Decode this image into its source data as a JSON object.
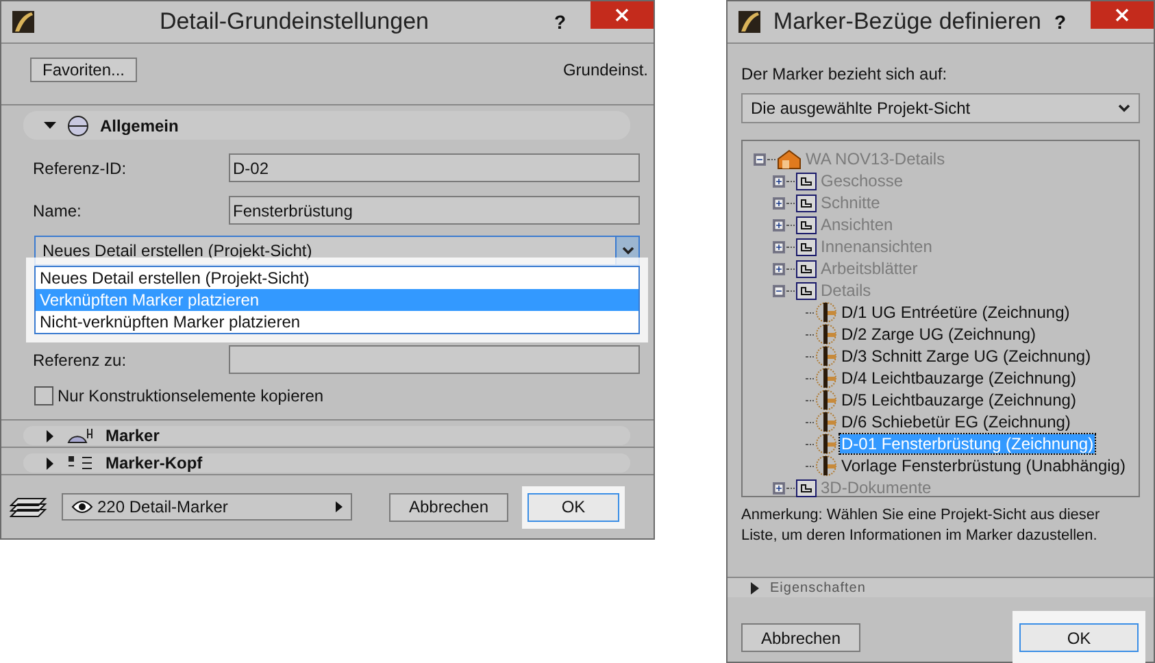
{
  "left_window": {
    "title": "Detail-Grundeinstellungen",
    "help": "?",
    "favorites_button": "Favoriten...",
    "preset_label": "Grundeinst.",
    "sections": [
      {
        "label": "Allgemein",
        "expanded": true
      },
      {
        "label": "Marker",
        "expanded": false
      },
      {
        "label": "Marker-Kopf",
        "expanded": false
      }
    ],
    "reference_id": {
      "label": "Referenz-ID:",
      "value": "D-02"
    },
    "name": {
      "label": "Name:",
      "value": "Fensterbrüstung"
    },
    "mode_dropdown": {
      "value": "Neues Detail erstellen (Projekt-Sicht)",
      "options": [
        {
          "label": "Neues Detail erstellen (Projekt-Sicht)",
          "highlighted": false
        },
        {
          "label": "Verknüpften Marker platzieren",
          "highlighted": true
        },
        {
          "label": "Nicht-verknüpften Marker platzieren",
          "highlighted": false
        }
      ]
    },
    "reference_to": {
      "label": "Referenz zu:"
    },
    "copy_construction_only": {
      "label": "Nur Konstruktionselemente kopieren",
      "checked": false
    },
    "layer_dropdown": "220 Detail-Marker",
    "cancel_button": "Abbrechen",
    "ok_button": "OK"
  },
  "right_window": {
    "title": "Marker-Bezüge definieren",
    "help": "?",
    "refers_label": "Der Marker bezieht sich auf:",
    "refers_dropdown": "Die ausgewählte Projekt-Sicht",
    "tree": [
      {
        "label": "WA NOV13-Details",
        "kind": "root",
        "expanded": true,
        "disabled": true,
        "selected": false,
        "children": [
          {
            "label": "Geschosse",
            "kind": "folder",
            "expanded": false,
            "disabled": true,
            "selected": false
          },
          {
            "label": "Schnitte",
            "kind": "folder",
            "expanded": false,
            "disabled": true,
            "selected": false
          },
          {
            "label": "Ansichten",
            "kind": "folder",
            "expanded": false,
            "disabled": true,
            "selected": false
          },
          {
            "label": "Innenansichten",
            "kind": "folder",
            "expanded": false,
            "disabled": true,
            "selected": false
          },
          {
            "label": "Arbeitsblätter",
            "kind": "folder",
            "expanded": false,
            "disabled": true,
            "selected": false
          },
          {
            "label": "Details",
            "kind": "folder",
            "expanded": true,
            "disabled": true,
            "selected": false,
            "children": [
              {
                "label": "D/1 UG Entréetüre (Zeichnung)",
                "kind": "drawing",
                "disabled": false,
                "selected": false
              },
              {
                "label": "D/2 Zarge UG (Zeichnung)",
                "kind": "drawing",
                "disabled": false,
                "selected": false
              },
              {
                "label": "D/3 Schnitt Zarge UG (Zeichnung)",
                "kind": "drawing",
                "disabled": false,
                "selected": false
              },
              {
                "label": "D/4 Leichtbauzarge (Zeichnung)",
                "kind": "drawing",
                "disabled": false,
                "selected": false
              },
              {
                "label": "D/5 Leichtbauzarge (Zeichnung)",
                "kind": "drawing",
                "disabled": false,
                "selected": false
              },
              {
                "label": "D/6 Schiebetür EG (Zeichnung)",
                "kind": "drawing",
                "disabled": false,
                "selected": false
              },
              {
                "label": "D-01 Fensterbrüstung (Zeichnung)",
                "kind": "drawing",
                "disabled": false,
                "selected": true
              },
              {
                "label": "Vorlage Fensterbrüstung (Unabhängig)",
                "kind": "drawing",
                "disabled": false,
                "selected": false
              }
            ]
          },
          {
            "label": "3D-Dokumente",
            "kind": "folder",
            "expanded": false,
            "disabled": true,
            "selected": false
          }
        ]
      }
    ],
    "note": "Anmerkung: Wählen Sie eine Projekt-Sicht aus dieser Liste, um deren Informationen im Marker dazustellen.",
    "properties_section": {
      "label": "Eigenschaften",
      "expanded": false
    },
    "cancel_button": "Abbrechen",
    "ok_button": "OK"
  }
}
